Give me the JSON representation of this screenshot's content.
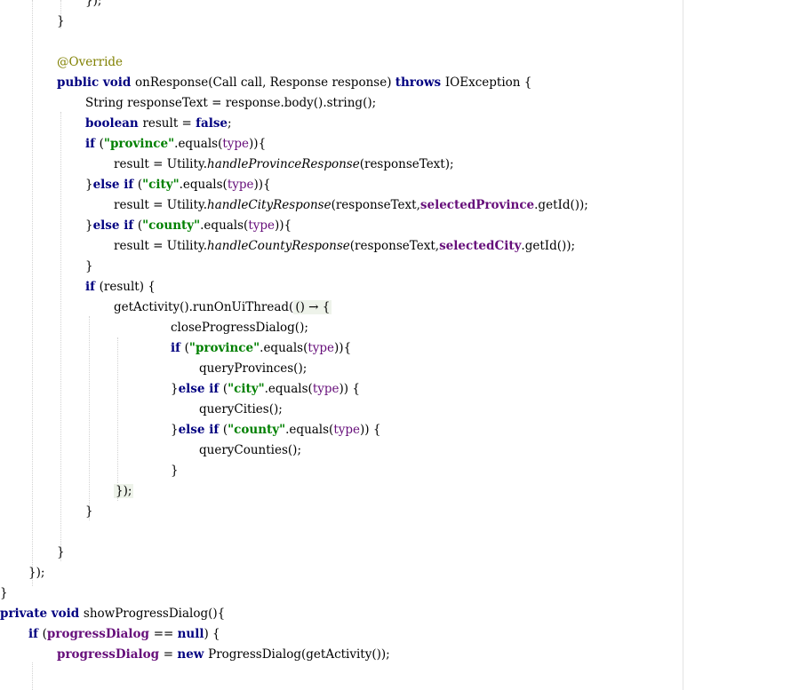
{
  "editor": {
    "lines": [
      {
        "indent": 96,
        "tokens": [
          {
            "t": "});",
            "c": "plain"
          }
        ]
      },
      {
        "indent": 64,
        "tokens": [
          {
            "t": "}",
            "c": "plain"
          }
        ]
      },
      {
        "indent": 0,
        "tokens": []
      },
      {
        "indent": 64,
        "tokens": [
          {
            "t": "@Override",
            "c": "ann"
          }
        ]
      },
      {
        "indent": 64,
        "tokens": [
          {
            "t": "public void ",
            "c": "kw"
          },
          {
            "t": "onResponse(Call call, Response response) ",
            "c": "plain"
          },
          {
            "t": "throws ",
            "c": "kw"
          },
          {
            "t": "IOException {",
            "c": "plain"
          }
        ]
      },
      {
        "indent": 96,
        "tokens": [
          {
            "t": "String responseText = response.body().string();",
            "c": "plain"
          }
        ]
      },
      {
        "indent": 96,
        "tokens": [
          {
            "t": "boolean ",
            "c": "kw"
          },
          {
            "t": "result = ",
            "c": "plain"
          },
          {
            "t": "false",
            "c": "kw"
          },
          {
            "t": ";",
            "c": "plain"
          }
        ]
      },
      {
        "indent": 96,
        "tokens": [
          {
            "t": "if ",
            "c": "kw"
          },
          {
            "t": "(",
            "c": "plain"
          },
          {
            "t": "\"province\"",
            "c": "str"
          },
          {
            "t": ".equals(",
            "c": "plain"
          },
          {
            "t": "type",
            "c": "param"
          },
          {
            "t": ")){",
            "c": "plain"
          }
        ]
      },
      {
        "indent": 128,
        "tokens": [
          {
            "t": "result = Utility.",
            "c": "plain"
          },
          {
            "t": "handleProvinceResponse",
            "c": "static-call"
          },
          {
            "t": "(responseText);",
            "c": "plain"
          }
        ]
      },
      {
        "indent": 96,
        "tokens": [
          {
            "t": "}",
            "c": "plain"
          },
          {
            "t": "else if ",
            "c": "kw"
          },
          {
            "t": "(",
            "c": "plain"
          },
          {
            "t": "\"city\"",
            "c": "str"
          },
          {
            "t": ".equals(",
            "c": "plain"
          },
          {
            "t": "type",
            "c": "param"
          },
          {
            "t": ")){",
            "c": "plain"
          }
        ]
      },
      {
        "indent": 128,
        "tokens": [
          {
            "t": "result = Utility.",
            "c": "plain"
          },
          {
            "t": "handleCityResponse",
            "c": "static-call"
          },
          {
            "t": "(responseText,",
            "c": "plain"
          },
          {
            "t": "selectedProvince",
            "c": "field"
          },
          {
            "t": ".getId());",
            "c": "plain"
          }
        ]
      },
      {
        "indent": 96,
        "tokens": [
          {
            "t": "}",
            "c": "plain"
          },
          {
            "t": "else if ",
            "c": "kw"
          },
          {
            "t": "(",
            "c": "plain"
          },
          {
            "t": "\"county\"",
            "c": "str"
          },
          {
            "t": ".equals(",
            "c": "plain"
          },
          {
            "t": "type",
            "c": "param"
          },
          {
            "t": ")){",
            "c": "plain"
          }
        ]
      },
      {
        "indent": 128,
        "tokens": [
          {
            "t": "result = Utility.",
            "c": "plain"
          },
          {
            "t": "handleCountyResponse",
            "c": "static-call"
          },
          {
            "t": "(responseText,",
            "c": "plain"
          },
          {
            "t": "selectedCity",
            "c": "field"
          },
          {
            "t": ".getId());",
            "c": "plain"
          }
        ]
      },
      {
        "indent": 96,
        "tokens": [
          {
            "t": "}",
            "c": "plain"
          }
        ]
      },
      {
        "indent": 96,
        "tokens": [
          {
            "t": "if ",
            "c": "kw"
          },
          {
            "t": "(result) {",
            "c": "plain"
          }
        ]
      },
      {
        "indent": 128,
        "tokens": [
          {
            "t": "getActivity().runOnUiThread(",
            "c": "plain"
          },
          {
            "t": "() → {",
            "c": "lambda-arrow"
          }
        ]
      },
      {
        "indent": 192,
        "tokens": [
          {
            "t": "closeProgressDialog();",
            "c": "plain"
          }
        ]
      },
      {
        "indent": 192,
        "tokens": [
          {
            "t": "if ",
            "c": "kw"
          },
          {
            "t": "(",
            "c": "plain"
          },
          {
            "t": "\"province\"",
            "c": "str"
          },
          {
            "t": ".equals(",
            "c": "plain"
          },
          {
            "t": "type",
            "c": "param"
          },
          {
            "t": ")){",
            "c": "plain"
          }
        ]
      },
      {
        "indent": 224,
        "tokens": [
          {
            "t": "queryProvinces();",
            "c": "plain"
          }
        ]
      },
      {
        "indent": 192,
        "tokens": [
          {
            "t": "}",
            "c": "plain"
          },
          {
            "t": "else if ",
            "c": "kw"
          },
          {
            "t": "(",
            "c": "plain"
          },
          {
            "t": "\"city\"",
            "c": "str"
          },
          {
            "t": ".equals(",
            "c": "plain"
          },
          {
            "t": "type",
            "c": "param"
          },
          {
            "t": ")) {",
            "c": "plain"
          }
        ]
      },
      {
        "indent": 224,
        "tokens": [
          {
            "t": "queryCities();",
            "c": "plain"
          }
        ]
      },
      {
        "indent": 192,
        "tokens": [
          {
            "t": "}",
            "c": "plain"
          },
          {
            "t": "else if ",
            "c": "kw"
          },
          {
            "t": "(",
            "c": "plain"
          },
          {
            "t": "\"county\"",
            "c": "str"
          },
          {
            "t": ".equals(",
            "c": "plain"
          },
          {
            "t": "type",
            "c": "param"
          },
          {
            "t": ")) {",
            "c": "plain"
          }
        ]
      },
      {
        "indent": 224,
        "tokens": [
          {
            "t": "queryCounties();",
            "c": "plain"
          }
        ]
      },
      {
        "indent": 192,
        "tokens": [
          {
            "t": "}",
            "c": "plain"
          }
        ]
      },
      {
        "indent": 128,
        "tokens": [
          {
            "t": "});",
            "c": "lambda-arrow"
          }
        ]
      },
      {
        "indent": 96,
        "tokens": [
          {
            "t": "}",
            "c": "plain"
          }
        ]
      },
      {
        "indent": 0,
        "tokens": []
      },
      {
        "indent": 64,
        "tokens": [
          {
            "t": "}",
            "c": "plain"
          }
        ]
      },
      {
        "indent": 32,
        "tokens": [
          {
            "t": "});",
            "c": "plain"
          }
        ]
      },
      {
        "indent": 0,
        "tokens": [
          {
            "t": "}",
            "c": "plain"
          }
        ]
      },
      {
        "indent": 0,
        "tokens": [
          {
            "t": "private void ",
            "c": "kw"
          },
          {
            "t": "showProgressDialog(){",
            "c": "plain"
          }
        ]
      },
      {
        "indent": 32,
        "tokens": [
          {
            "t": "if ",
            "c": "kw"
          },
          {
            "t": "(",
            "c": "plain"
          },
          {
            "t": "progressDialog ",
            "c": "field"
          },
          {
            "t": "== ",
            "c": "plain"
          },
          {
            "t": "null",
            "c": "kw"
          },
          {
            "t": ") {",
            "c": "plain"
          }
        ]
      },
      {
        "indent": 64,
        "tokens": [
          {
            "t": "progressDialog ",
            "c": "field"
          },
          {
            "t": "= ",
            "c": "plain"
          },
          {
            "t": "new ",
            "c": "kw"
          },
          {
            "t": "ProgressDialog(getActivity());",
            "c": "plain"
          }
        ]
      }
    ]
  }
}
